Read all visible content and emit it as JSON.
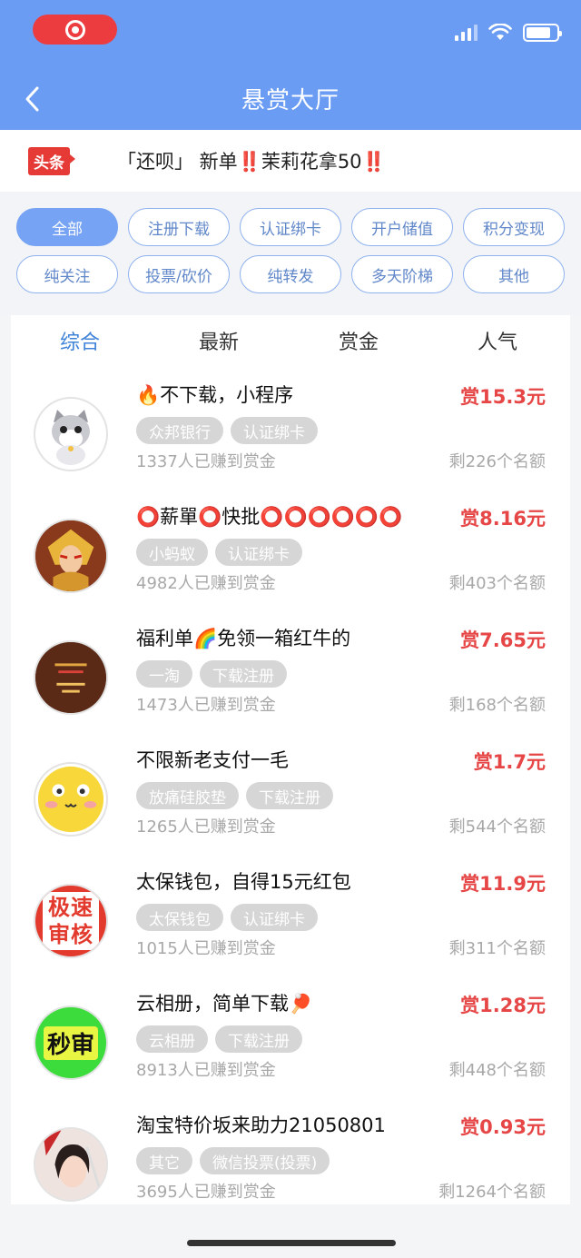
{
  "header": {
    "title": "悬赏大厅",
    "brand_color": "#6b9cf4"
  },
  "ticker": {
    "badge": "头条",
    "text": "「还呗」 新单‼️茉莉花拿50‼️"
  },
  "filters": [
    {
      "label": "全部",
      "active": true
    },
    {
      "label": "注册下载",
      "active": false
    },
    {
      "label": "认证绑卡",
      "active": false
    },
    {
      "label": "开户储值",
      "active": false
    },
    {
      "label": "积分变现",
      "active": false
    },
    {
      "label": "纯关注",
      "active": false
    },
    {
      "label": "投票/砍价",
      "active": false
    },
    {
      "label": "纯转发",
      "active": false
    },
    {
      "label": "多天阶梯",
      "active": false
    },
    {
      "label": "其他",
      "active": false
    }
  ],
  "sort_tabs": [
    {
      "label": "综合",
      "active": true
    },
    {
      "label": "最新",
      "active": false
    },
    {
      "label": "赏金",
      "active": false
    },
    {
      "label": "人气",
      "active": false
    }
  ],
  "items": [
    {
      "title": "🔥不下载，小程序",
      "reward": "赏15.3元",
      "tags": [
        "众邦银行",
        "认证绑卡"
      ],
      "earned": "1337人已赚到赏金",
      "remain": "剩226个名额",
      "avatar": "kitten-avatar"
    },
    {
      "title": "⭕薪單⭕快批⭕⭕⭕⭕⭕⭕",
      "reward": "赏8.16元",
      "tags": [
        "小蚂蚁",
        "认证绑卡"
      ],
      "earned": "4982人已赚到赏金",
      "remain": "剩403个名额",
      "avatar": "warrior-avatar"
    },
    {
      "title": "福利单🌈免领一箱红牛的",
      "reward": "赏7.65元",
      "tags": [
        "一淘",
        "下载注册"
      ],
      "earned": "1473人已赚到赏金",
      "remain": "剩168个名额",
      "avatar": "text-avatar"
    },
    {
      "title": "不限新老支付一毛",
      "reward": "赏1.7元",
      "tags": [
        "放痛硅胶垫",
        "下载注册"
      ],
      "earned": "1265人已赚到赏金",
      "remain": "剩544个名额",
      "avatar": "smiley-avatar"
    },
    {
      "title": "太保钱包，自得15元红包",
      "reward": "赏11.9元",
      "tags": [
        "太保钱包",
        "认证绑卡"
      ],
      "earned": "1015人已赚到赏金",
      "remain": "剩311个名额",
      "avatar": "express-review-avatar",
      "avatar_text": "极速审核"
    },
    {
      "title": "云相册，简单下载🏓",
      "reward": "赏1.28元",
      "tags": [
        "云相册",
        "下载注册"
      ],
      "earned": "8913人已赚到赏金",
      "remain": "剩448个名额",
      "avatar": "second-review-avatar",
      "avatar_text": "秒审"
    },
    {
      "title": "淘宝特价坂来助力21050801",
      "reward": "赏0.93元",
      "tags": [
        "其它",
        "微信投票(投票)"
      ],
      "earned": "3695人已赚到赏金",
      "remain": "剩1264个名额",
      "avatar": "portrait-avatar"
    }
  ]
}
